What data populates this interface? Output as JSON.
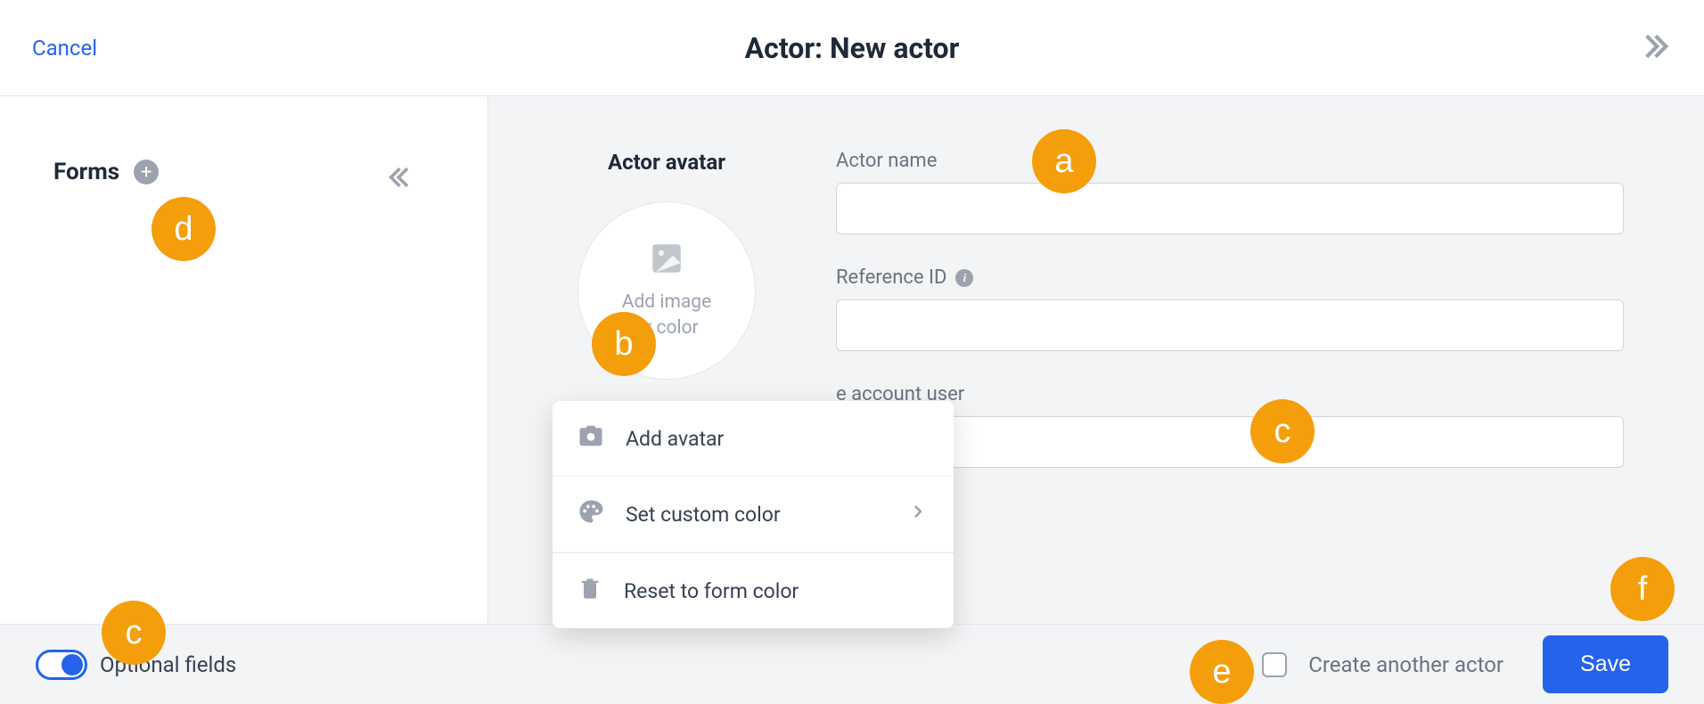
{
  "header": {
    "cancel_label": "Cancel",
    "title": "Actor: New actor"
  },
  "sidebar": {
    "title": "Forms"
  },
  "avatar": {
    "section_label": "Actor avatar",
    "placeholder_line1": "Add image",
    "placeholder_line2": "or color"
  },
  "fields": {
    "actor_name": {
      "label": "Actor name",
      "value": ""
    },
    "reference_id": {
      "label": "Reference ID",
      "value": ""
    },
    "account_user": {
      "label_partial": "e account user",
      "value": ""
    }
  },
  "avatar_menu": {
    "add_avatar": "Add avatar",
    "set_custom_color": "Set custom color",
    "reset": "Reset to form color"
  },
  "footer": {
    "optional_fields_label": "Optional fields",
    "create_another_label": "Create another actor",
    "save_label": "Save"
  },
  "annotations": {
    "a": "a",
    "b": "b",
    "c": "c",
    "d": "d",
    "e": "e",
    "f": "f"
  }
}
